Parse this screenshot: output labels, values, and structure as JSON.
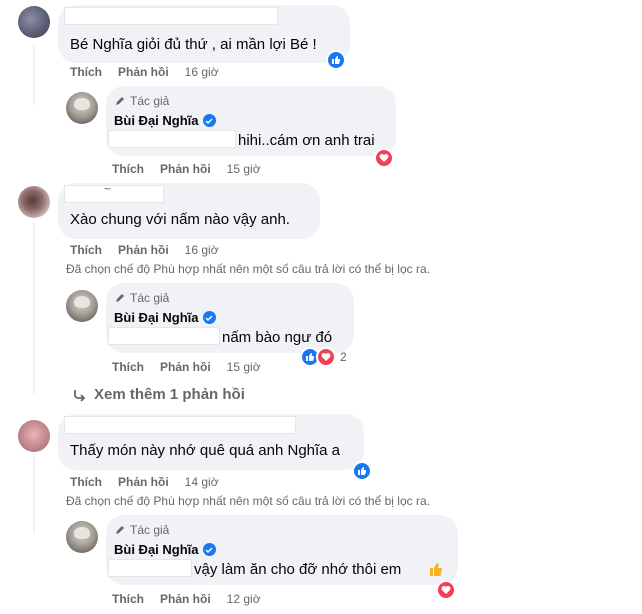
{
  "comments": [
    {
      "text": "Bé Nghĩa giỏi đủ thứ , ai mần lợi Bé !",
      "actions": {
        "like": "Thích",
        "reply": "Phản hồi",
        "time": "16 giờ"
      },
      "reaction": "like-icon",
      "reply": {
        "author_tag": "Tác giả",
        "author_name": "Bùi Đại Nghĩa",
        "text": "hihi..cám ơn anh trai",
        "actions": {
          "like": "Thích",
          "reply": "Phản hồi",
          "time": "15 giờ"
        },
        "reaction": "love-icon"
      }
    },
    {
      "name_fragment": "~",
      "text": "Xào chung với nấm nào vậy anh.",
      "actions": {
        "like": "Thích",
        "reply": "Phản hồi",
        "time": "16 giờ"
      },
      "filter_note": "Đã chọn chế độ Phù hợp nhất nên một số câu trả lời có thể bị lọc ra.",
      "reply": {
        "author_tag": "Tác giả",
        "author_name": "Bùi Đại Nghĩa",
        "text": "nấm bào ngư đó",
        "actions": {
          "like": "Thích",
          "reply": "Phản hồi",
          "time": "15 giờ"
        },
        "reaction_count": "2"
      },
      "more_replies": "Xem thêm 1 phản hồi"
    },
    {
      "text": "Thấy món này nhớ quê quá anh Nghĩa a",
      "actions": {
        "like": "Thích",
        "reply": "Phản hồi",
        "time": "14 giờ"
      },
      "filter_note": "Đã chọn chế độ Phù hợp nhất nên một số câu trả lời có thể bị lọc ra.",
      "reaction": "like-icon",
      "reply": {
        "author_tag": "Tác giả",
        "author_name": "Bùi Đại Nghĩa",
        "text": "vậy làm ăn cho đỡ nhớ thôi em",
        "actions": {
          "like": "Thích",
          "reply": "Phản hồi",
          "time": "12 giờ"
        },
        "reaction": "love-icon"
      }
    }
  ],
  "colors": {
    "bubble": "#f0f2f5",
    "muted_text": "#65676b",
    "like_blue": "#1877f2",
    "love_red": "#f33e58"
  }
}
